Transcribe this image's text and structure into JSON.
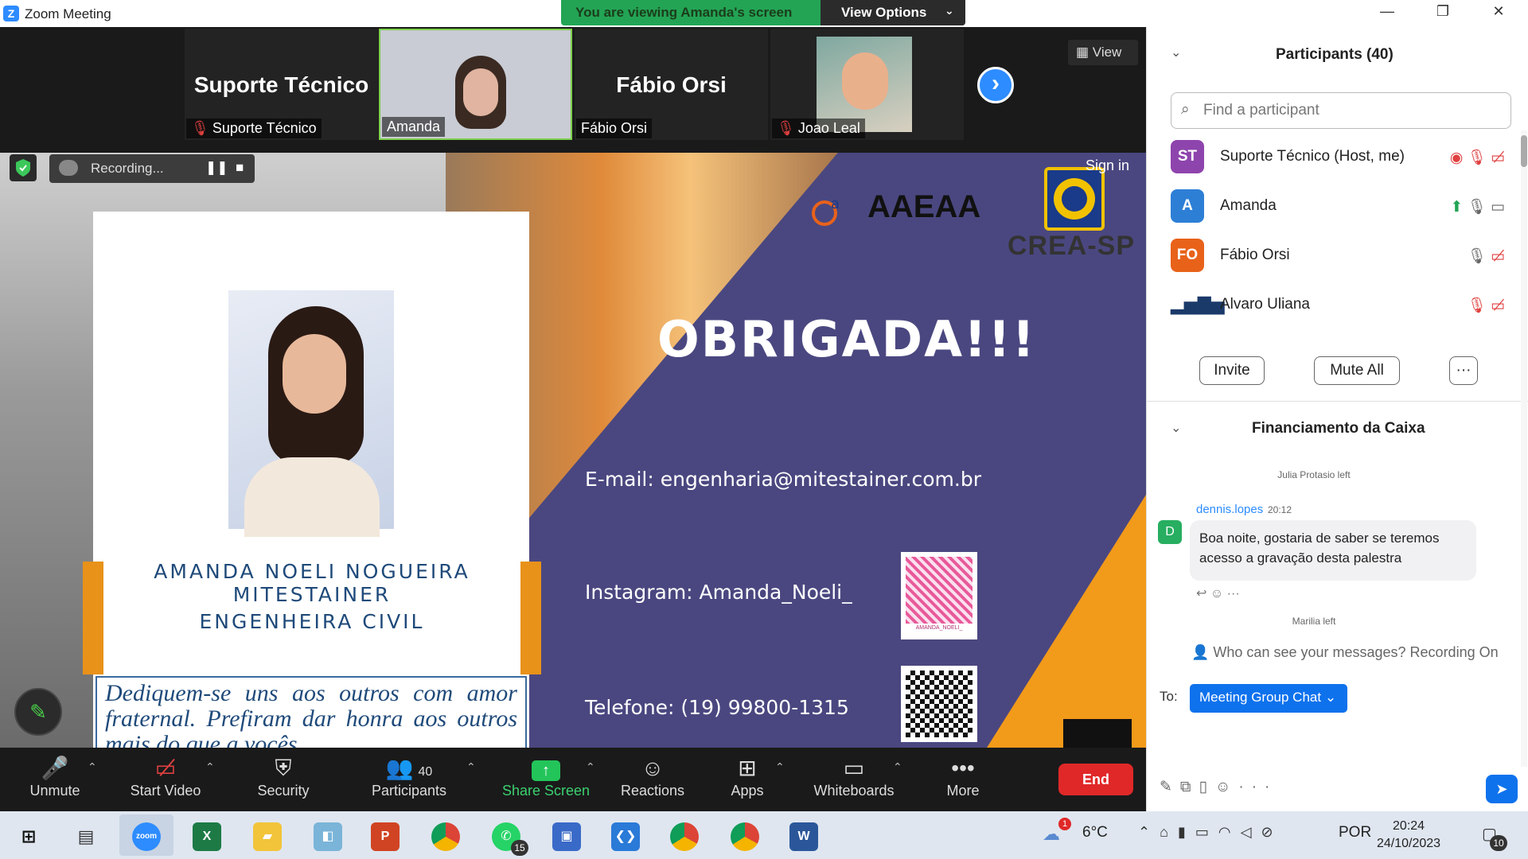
{
  "window": {
    "app_icon": "Z",
    "title": "Zoom Meeting",
    "viewing_banner": "You are viewing Amanda's screen",
    "view_options_label": "View Options",
    "view_button_label": "View"
  },
  "filmstrip": {
    "tiles": [
      {
        "name_big": "Suporte Técnico",
        "label": "Suporte Técnico",
        "muted": true
      },
      {
        "name_big": "",
        "label": "Amanda",
        "muted": false
      },
      {
        "name_big": "Fábio Orsi",
        "label": "Fábio Orsi",
        "muted": false
      },
      {
        "name_big": "",
        "label": "Joao Leal",
        "muted": true
      }
    ]
  },
  "recording": {
    "label": "Recording..."
  },
  "slide": {
    "sign_in": "Sign in",
    "card_name": "AMANDA NOELI NOGUEIRA MITESTAINER",
    "card_role": "ENGENHEIRA CIVIL",
    "quote": "Dediquem-se uns aos outros com amor fraternal. Prefiram dar honra aos outros mais do que a vocês",
    "thanks": "OBRIGADA!!!",
    "email": "E-mail: engenharia@mitestainer.com.br",
    "instagram": "Instagram: Amanda_Noeli_",
    "phone": "Telefone: (19) 99800-1315",
    "qr_label": "AMANDA_NOELI_",
    "org1": "AAEAA",
    "org2": "CREA-SP"
  },
  "toolbar": {
    "unmute": "Unmute",
    "start_video": "Start Video",
    "security": "Security",
    "participants": "Participants",
    "participants_count": "40",
    "share_screen": "Share Screen",
    "reactions": "Reactions",
    "apps": "Apps",
    "whiteboards": "Whiteboards",
    "more": "More",
    "end": "End"
  },
  "participants_panel": {
    "header": "Participants (40)",
    "search_placeholder": "Find a participant",
    "participants": [
      {
        "initials": "ST",
        "name": "Suporte Técnico (Host, me)",
        "color": "#8e44ad"
      },
      {
        "initials": "A",
        "name": "Amanda",
        "color": "#2d7fd6"
      },
      {
        "initials": "FO",
        "name": "Fábio Orsi",
        "color": "#e8621a"
      },
      {
        "initials": "",
        "name": "Alvaro Uliana",
        "color": "#ffffff"
      }
    ],
    "invite": "Invite",
    "mute_all": "Mute All",
    "more": "···"
  },
  "chat_panel": {
    "header": "Financiamento da Caixa",
    "system_1": "Julia Protasio left",
    "sender": "dennis.lopes",
    "sender_initial": "D",
    "time": "20:12",
    "message": "Boa noite, gostaria de saber se teremos acesso a gravação desta palestra",
    "system_2": "Marilia left",
    "who_can_see": "Who can see your messages? Recording On",
    "to_label": "To:",
    "to_value": "Meeting Group Chat"
  },
  "taskbar": {
    "weather_temp": "6°C",
    "language": "POR",
    "time": "20:24",
    "date": "24/10/2023",
    "whatsapp_badge": "15",
    "notifications": "10",
    "weather_badge": "1"
  },
  "colors": {
    "zoom_blue": "#0e72ed",
    "banner_green": "#23a455",
    "end_red": "#e02828",
    "slide_purple": "#4a4780",
    "slide_orange": "#f29a1a"
  }
}
